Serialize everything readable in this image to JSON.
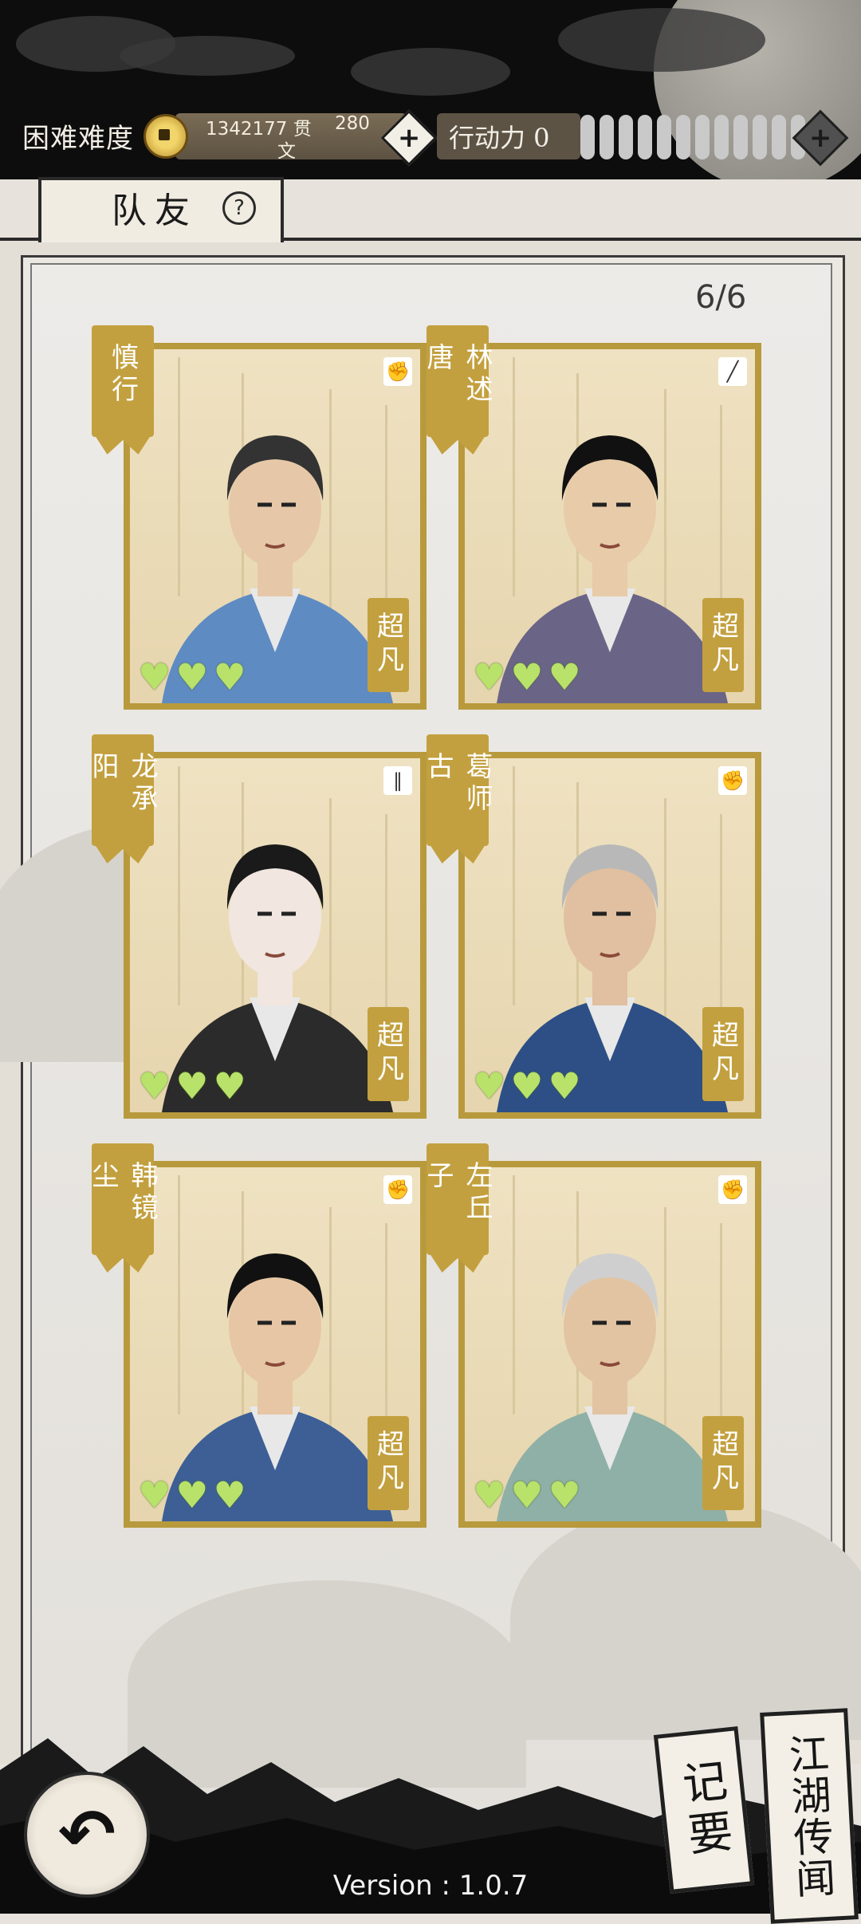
{
  "header": {
    "difficulty": "困难难度",
    "money_line1": "1342177 贯",
    "money_line1b": "280",
    "money_line2": "文",
    "stamina_label": "行动力 0",
    "stamina_bars": 12
  },
  "tab": {
    "label": "队友",
    "help": "?"
  },
  "party_count": "6/6",
  "cards": [
    {
      "name": "慎行",
      "rank": "超凡",
      "hearts": 3,
      "type_icon": "fist-icon"
    },
    {
      "name": "林述唐",
      "rank": "超凡",
      "hearts": 3,
      "type_icon": "sword-icon"
    },
    {
      "name": "龙承阳",
      "rank": "超凡",
      "hearts": 3,
      "type_icon": "dual-blade-icon"
    },
    {
      "name": "葛师古",
      "rank": "超凡",
      "hearts": 3,
      "type_icon": "fist-icon"
    },
    {
      "name": "韩镜尘",
      "rank": "超凡",
      "hearts": 3,
      "type_icon": "fist-icon"
    },
    {
      "name": "左丘子",
      "rank": "超凡",
      "hearts": 3,
      "type_icon": "fist-icon"
    }
  ],
  "bottom": {
    "notes_label": "记要",
    "rumors_label": "江湖传闻",
    "version": "Version : 1.0.7"
  }
}
